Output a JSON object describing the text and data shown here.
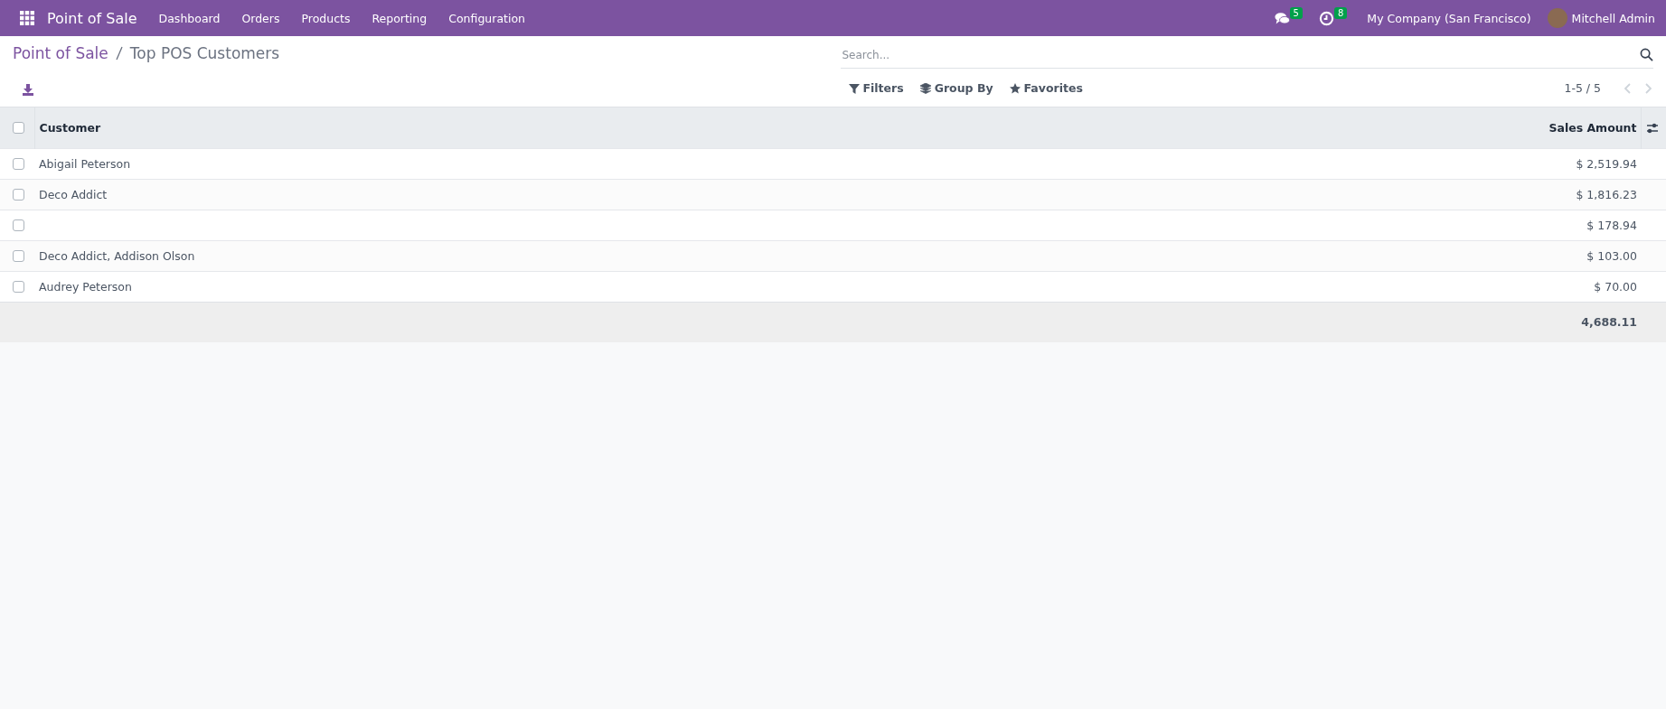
{
  "navbar": {
    "app_name": "Point of Sale",
    "menu": [
      "Dashboard",
      "Orders",
      "Products",
      "Reporting",
      "Configuration"
    ],
    "messages_badge": "5",
    "activities_badge": "8",
    "company": "My Company (San Francisco)",
    "user": "Mitchell Admin"
  },
  "breadcrumb": {
    "parent": "Point of Sale",
    "current": "Top POS Customers"
  },
  "search": {
    "placeholder": "Search..."
  },
  "filters": [
    "Filters",
    "Group By",
    "Favorites"
  ],
  "pager": "1-5 / 5",
  "table": {
    "all_selected": false,
    "columns": [
      "Customer",
      "Sales Amount"
    ],
    "rows": [
      {
        "customer": "Abigail Peterson",
        "amount": "$ 2,519.94",
        "selected": false
      },
      {
        "customer": "Deco Addict",
        "amount": "$ 1,816.23",
        "selected": false
      },
      {
        "amount": "$ 178.94",
        "selected": false
      },
      {
        "customer": "Deco Addict, Addison Olson",
        "amount": "$ 103.00",
        "selected": false
      },
      {
        "customer": "Audrey Peterson",
        "amount": "$ 70.00",
        "selected": false
      }
    ],
    "total": "4,688.11"
  }
}
